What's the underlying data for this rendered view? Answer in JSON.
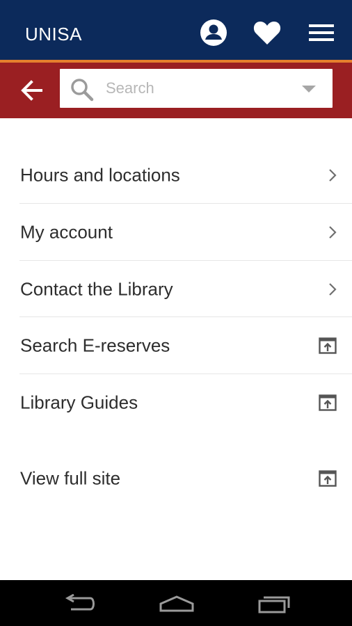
{
  "app": {
    "title": "UNISA"
  },
  "header": {
    "icons": [
      "account-icon",
      "heart-icon",
      "hamburger-menu-icon"
    ]
  },
  "search": {
    "placeholder": "Search",
    "icons": [
      "back-arrow-icon",
      "search-icon",
      "dropdown-caret-icon"
    ]
  },
  "menu": {
    "items": [
      {
        "label": "Hours and locations",
        "icon": "chevron-right-icon"
      },
      {
        "label": "My account",
        "icon": "chevron-right-icon"
      },
      {
        "label": "Contact the Library",
        "icon": "chevron-right-icon"
      },
      {
        "label": "Search E-reserves",
        "icon": "external-link-icon"
      },
      {
        "label": "Library Guides",
        "icon": "external-link-icon"
      },
      {
        "label": "View full site",
        "icon": "external-link-icon"
      }
    ]
  },
  "system_nav": {
    "icons": [
      "system-back-icon",
      "system-home-icon",
      "system-recents-icon"
    ]
  },
  "colors": {
    "header_bg": "#0c2a5b",
    "accent_line": "#e57f2d",
    "search_bar_bg": "#9a1f22",
    "nav_bg": "#000000"
  }
}
